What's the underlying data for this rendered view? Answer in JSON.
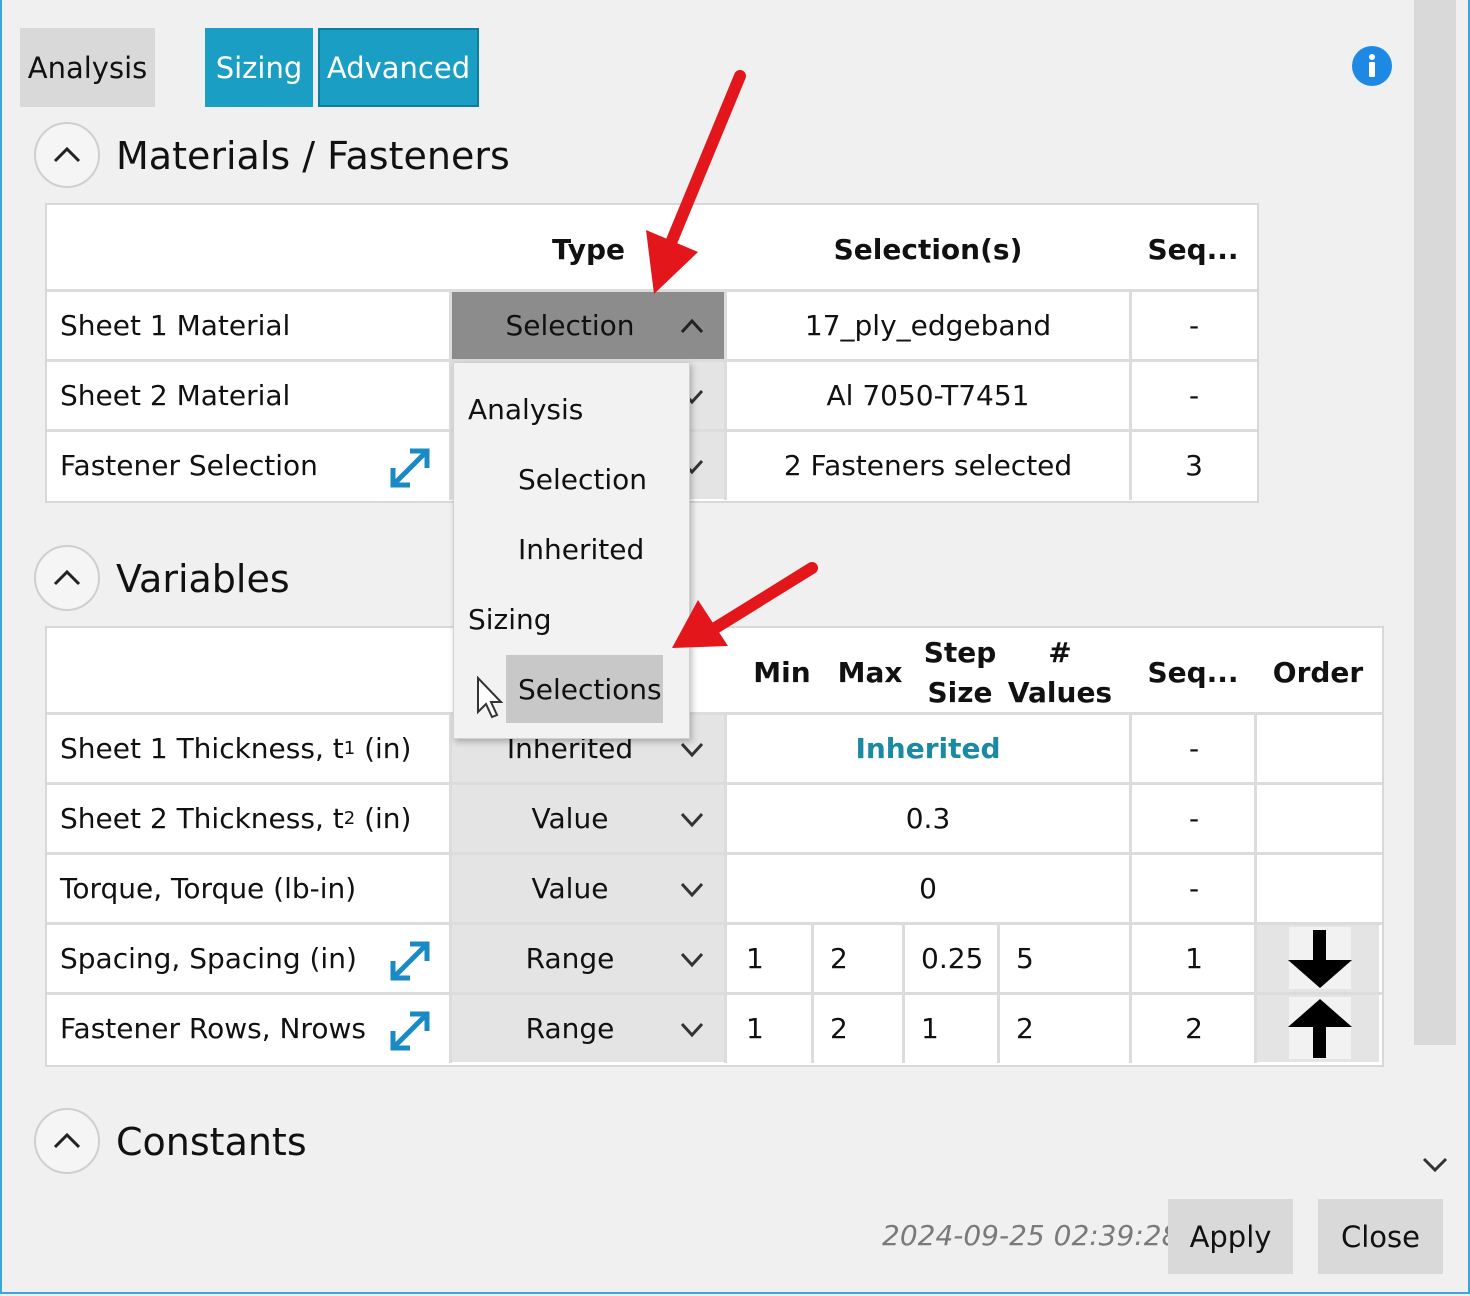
{
  "tabs": {
    "analysis": "Analysis",
    "sizing": "Sizing",
    "advanced": "Advanced"
  },
  "colors": {
    "accent": "#1a9ec4",
    "link": "#1a8aa4",
    "info": "#1e88e5",
    "arrow": "#e3161b"
  },
  "materials": {
    "title": "Materials / Fasteners",
    "headers": {
      "type": "Type",
      "selections": "Selection(s)",
      "seq": "Seq..."
    },
    "rows": [
      {
        "label": "Sheet 1 Material",
        "type": "Selection",
        "selection": "17_ply_edgeband",
        "seq": "-"
      },
      {
        "label": "Sheet 2 Material",
        "selection": "Al 7050-T7451",
        "seq": "-"
      },
      {
        "label": "Fastener Selection",
        "selection": "2 Fasteners selected",
        "seq": "3"
      }
    ]
  },
  "dropdown_menu": {
    "group1": "Analysis",
    "item1": "Selection",
    "item2": "Inherited",
    "group2": "Sizing",
    "item3": "Selections"
  },
  "variables": {
    "title": "Variables",
    "headers": {
      "min": "Min",
      "max": "Max",
      "step": "Step Size",
      "values": "# Values",
      "seq": "Seq...",
      "order": "Order"
    },
    "rows": [
      {
        "label": "Sheet 1 Thickness, t",
        "sub": "1",
        "unit": " (in)",
        "type": "Inherited",
        "value": "Inherited",
        "seq": "-"
      },
      {
        "label": "Sheet 2 Thickness, t",
        "sub": "2",
        "unit": " (in)",
        "type": "Value",
        "value": "0.3",
        "seq": "-"
      },
      {
        "label": "Torque, Torque (lb-in)",
        "type": "Value",
        "value": "0",
        "seq": "-"
      },
      {
        "label": "Spacing, Spacing (in)",
        "type": "Range",
        "min": "1",
        "max": "2",
        "step": "0.25",
        "values": "5",
        "seq": "1",
        "order": "down-arrow"
      },
      {
        "label": "Fastener Rows, Nrows",
        "type": "Range",
        "min": "1",
        "max": "2",
        "step": "1",
        "values": "2",
        "seq": "2",
        "order": "up-arrow"
      }
    ]
  },
  "constants": {
    "title": "Constants"
  },
  "footer": {
    "timestamp": "2024-09-25 02:39:28",
    "apply": "Apply",
    "close": "Close"
  }
}
